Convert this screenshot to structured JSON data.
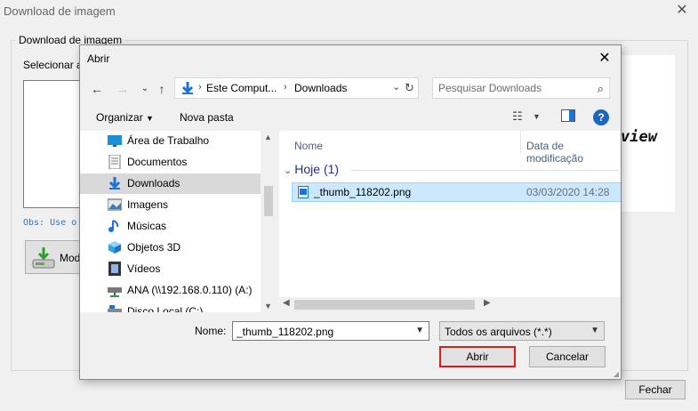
{
  "parent_window": {
    "title": "Download de imagem",
    "group_label": "Download de imagem",
    "select_label": "Selecionar ar",
    "obs_text": "Obs: Use o",
    "mod_button_label": "Mod",
    "preview_text": "view",
    "close_button_label": "Fechar"
  },
  "dialog": {
    "title": "Abrir",
    "address": {
      "crumbs": [
        "Este Comput...",
        "Downloads"
      ]
    },
    "search": {
      "placeholder": "Pesquisar Downloads"
    },
    "toolbar": {
      "organize_label": "Organizar",
      "new_folder_label": "Nova pasta"
    },
    "nav_items": [
      {
        "label": "Área de Trabalho",
        "icon": "desktop-icon"
      },
      {
        "label": "Documentos",
        "icon": "documents-icon"
      },
      {
        "label": "Downloads",
        "icon": "download-arrow-icon",
        "selected": true
      },
      {
        "label": "Imagens",
        "icon": "pictures-icon"
      },
      {
        "label": "Músicas",
        "icon": "music-note-icon"
      },
      {
        "label": "Objetos 3D",
        "icon": "cube-icon"
      },
      {
        "label": "Vídeos",
        "icon": "film-icon"
      },
      {
        "label": "ANA (\\\\192.168.0.110) (A:)",
        "icon": "network-drive-icon"
      },
      {
        "label": "Disco Local (C:)",
        "icon": "local-disk-icon"
      }
    ],
    "columns": {
      "name": "Nome",
      "date": "Data de modificação"
    },
    "group_heading": "Hoje (1)",
    "files": [
      {
        "name": "_thumb_118202.png",
        "date": "03/03/2020 14:28",
        "icon": "image-file-icon"
      }
    ],
    "file_name_label": "Nome:",
    "file_name_value": "_thumb_118202.png",
    "file_type_filter": "Todos os arquivos (*.*)",
    "open_button_label": "Abrir",
    "cancel_button_label": "Cancelar"
  },
  "colors": {
    "selection_bg": "#cce8ff",
    "selection_border": "#99d1ff",
    "group_heading": "#1e3287",
    "highlight_border": "#e01b1b",
    "help_icon": "#1b66c2"
  }
}
